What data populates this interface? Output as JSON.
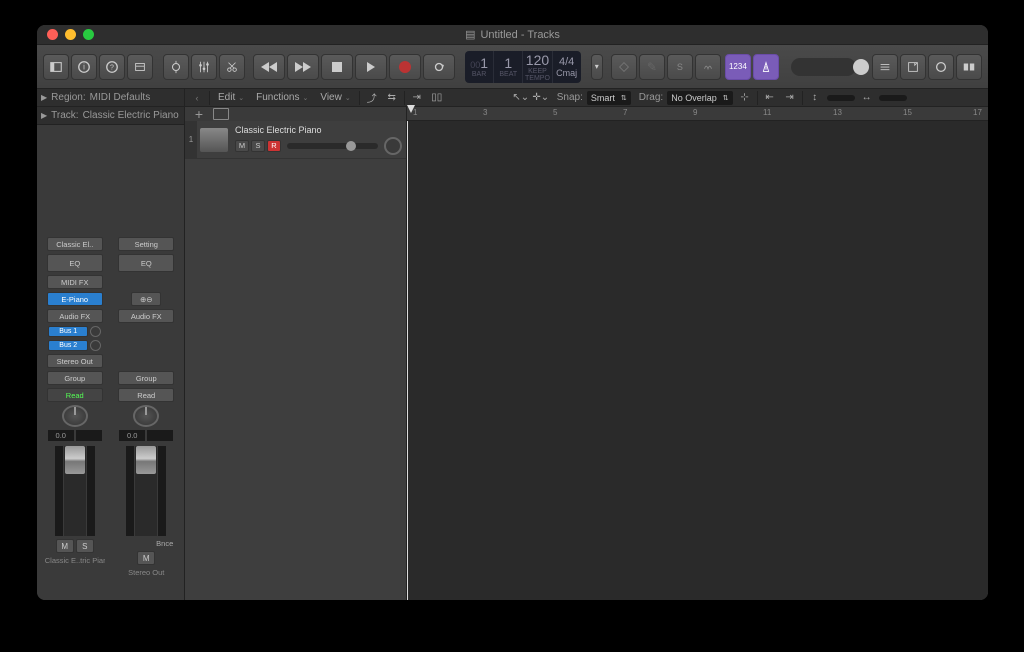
{
  "window": {
    "title": "Untitled - Tracks"
  },
  "traffic": {
    "close": "#ff5f57",
    "min": "#ffbd2e",
    "max": "#28c940"
  },
  "transport": {
    "bar_dim": "00",
    "bar": "1",
    "beat": "1",
    "bar_label": "BAR",
    "beat_label": "BEAT",
    "tempo": "120",
    "tempo_sub": "KEEP",
    "tempo_label": "TEMPO",
    "sig": "4/4",
    "key": "Cmaj",
    "purple": "1234"
  },
  "inspector": {
    "region_label": "Region:",
    "region_value": "MIDI Defaults",
    "track_label": "Track:",
    "track_value": "Classic Electric Piano"
  },
  "strip1": {
    "name": "Classic El..",
    "eq": "EQ",
    "midifx": "MIDI FX",
    "inst": "E-Piano",
    "audiofx": "Audio FX",
    "send1": "Bus 1",
    "send2": "Bus 2",
    "out": "Stereo Out",
    "group": "Group",
    "read": "Read",
    "pan": "0.0",
    "m": "M",
    "s": "S",
    "label": "Classic E..tric Piano"
  },
  "strip2": {
    "name": "Setting",
    "eq": "EQ",
    "stereo": "⊕⊖",
    "audiofx": "Audio FX",
    "group": "Group",
    "read": "Read",
    "pan": "0.0",
    "bnce": "Bnce",
    "m": "M",
    "label": "Stereo Out"
  },
  "track_toolbar": {
    "edit": "Edit",
    "functions": "Functions",
    "view": "View",
    "snap_label": "Snap:",
    "snap_value": "Smart",
    "drag_label": "Drag:",
    "drag_value": "No Overlap"
  },
  "ruler": {
    "marks": [
      "1",
      "3",
      "5",
      "7",
      "9",
      "11",
      "13",
      "15",
      "17"
    ]
  },
  "track": {
    "num": "1",
    "name": "Classic Electric Piano",
    "m": "M",
    "s": "S",
    "r": "R"
  }
}
